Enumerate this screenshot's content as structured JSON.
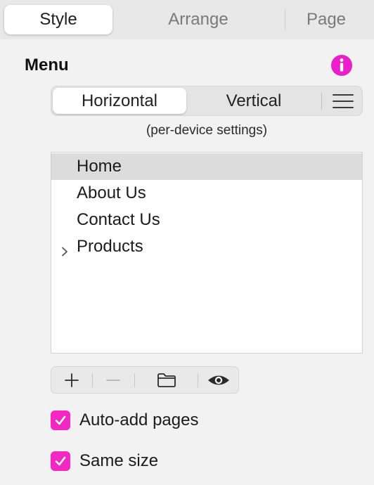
{
  "tabs": [
    {
      "label": "Style",
      "active": true
    },
    {
      "label": "Arrange",
      "active": false
    },
    {
      "label": "Page",
      "active": false
    }
  ],
  "section": {
    "title": "Menu",
    "info_icon": "info-icon",
    "accent": "#ea1fcb"
  },
  "orientation": {
    "options": [
      "Horizontal",
      "Vertical"
    ],
    "selected": "Horizontal",
    "menu_icon": "hamburger-icon",
    "note": "(per-device settings)"
  },
  "menu_items": [
    {
      "label": "Home",
      "selected": true,
      "expandable": false
    },
    {
      "label": "About Us",
      "selected": false,
      "expandable": false
    },
    {
      "label": "Contact Us",
      "selected": false,
      "expandable": false
    },
    {
      "label": "Products",
      "selected": false,
      "expandable": true
    }
  ],
  "toolbar": {
    "buttons": [
      {
        "name": "add",
        "icon": "plus-icon",
        "enabled": true
      },
      {
        "name": "remove",
        "icon": "minus-icon",
        "enabled": false
      },
      {
        "name": "folder",
        "icon": "folder-icon",
        "enabled": true
      },
      {
        "name": "visibility",
        "icon": "eye-icon",
        "enabled": true
      }
    ]
  },
  "options": {
    "auto_add": {
      "label": "Auto-add pages",
      "checked": true
    },
    "same_size": {
      "label": "Same size",
      "checked": true
    },
    "checkbox_color": "#f227c4"
  }
}
